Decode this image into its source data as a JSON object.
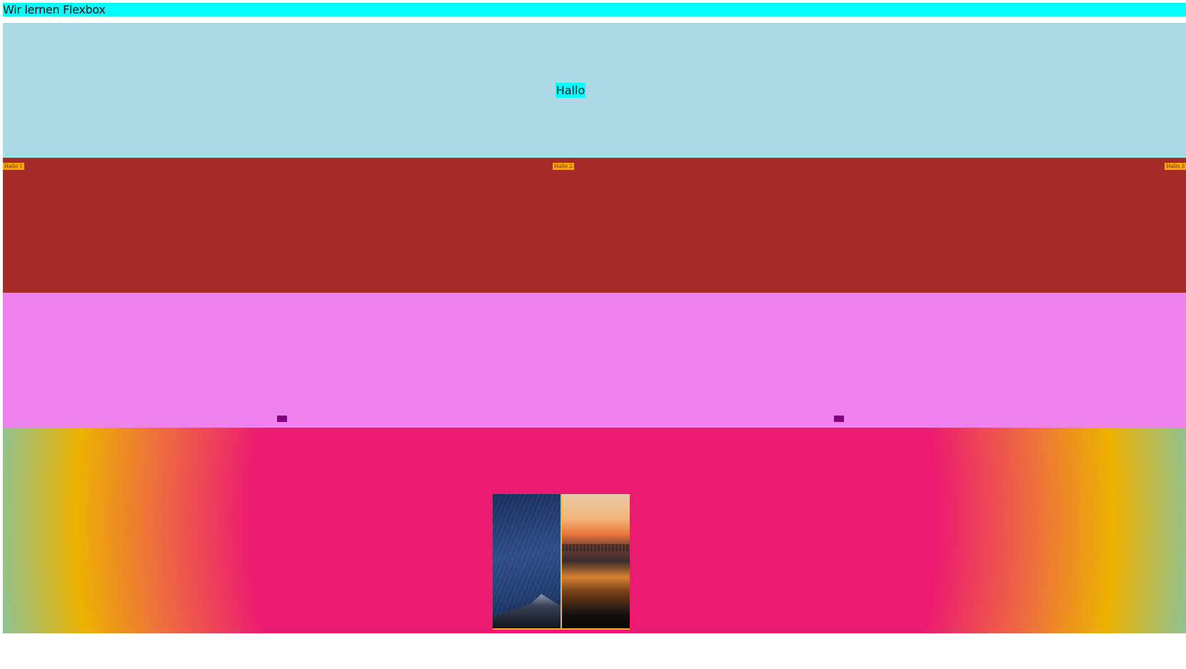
{
  "page": {
    "heading": "Wir lernen Flexbox"
  },
  "section_center": {
    "label": "Hallo",
    "background": "#add8e6",
    "box_color": "#00ffff"
  },
  "section_spread": {
    "background": "#a52a2a",
    "tag_color": "#ffa500",
    "items": [
      "Hallo 1",
      "Hallo 2",
      "Hallo 3"
    ]
  },
  "section_boxes": {
    "background": "#ee82ee",
    "box_color": "#800080"
  },
  "section_images": {
    "gradient_colors": [
      "#ed1a72",
      "#ee6e3e",
      "#edb200",
      "#9ec07a",
      "#4fd0f3"
    ],
    "border_color": "#f3b61a",
    "images": [
      "starry-sky-photo",
      "sunset-beach-photo"
    ]
  }
}
